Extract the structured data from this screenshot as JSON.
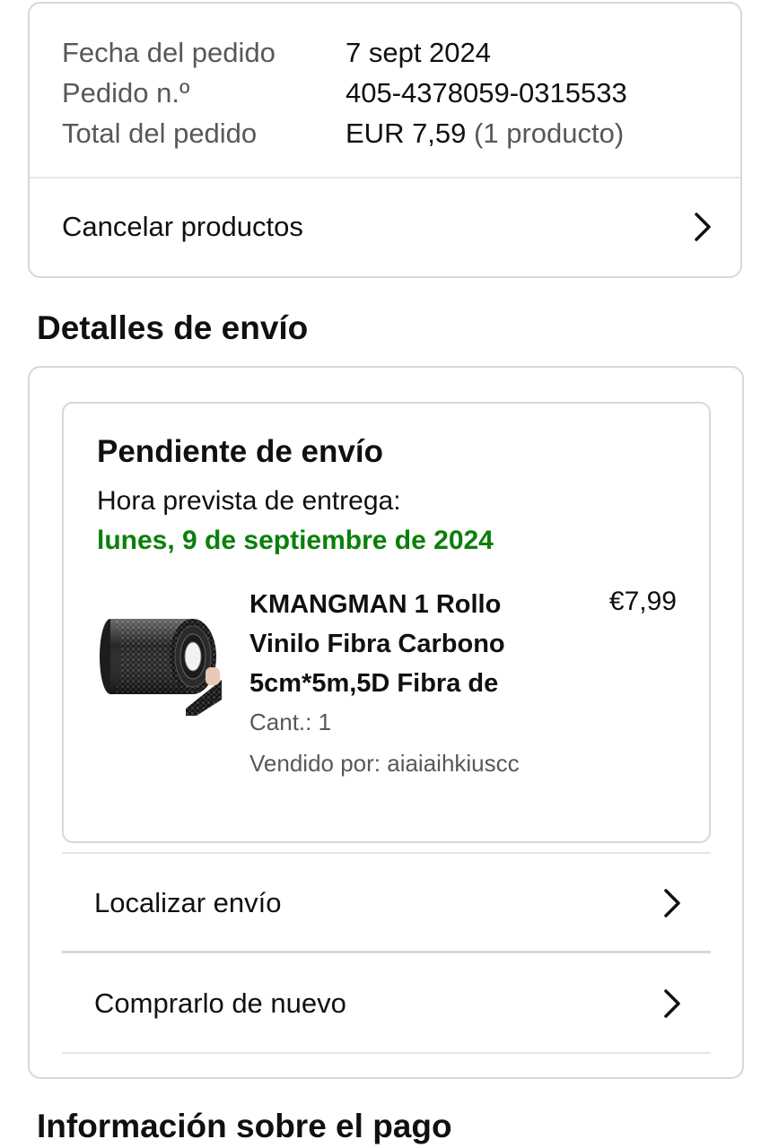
{
  "order_summary": {
    "rows": [
      {
        "label": "Fecha del pedido",
        "value": "7 sept 2024"
      },
      {
        "label": "Pedido n.º",
        "value": "405-4378059-0315533"
      },
      {
        "label": "Total del pedido",
        "value": "EUR 7,59",
        "value_extra": "(1 producto)"
      }
    ],
    "cancel_label": "Cancelar productos"
  },
  "shipping": {
    "section_title": "Detalles de envío",
    "status": "Pendiente de envío",
    "eta_label": "Hora prevista de entrega:",
    "eta_date": "lunes, 9 de septiembre de 2024",
    "product": {
      "title_lines": [
        "KMANGMAN 1 Rollo",
        "Vinilo Fibra Carbono",
        "5cm*5m,5D Fibra de"
      ],
      "price": "€7,99",
      "quantity": "Cant.: 1",
      "seller": "Vendido por: aiaiaihkiuscc",
      "image": "carbon-fiber-vinyl-roll"
    },
    "track_label": "Localizar envío",
    "buy_again_label": "Comprarlo de nuevo"
  },
  "payment": {
    "section_title": "Información sobre el pago"
  },
  "colors": {
    "eta_green": "#0b7f0b",
    "border": "#d5d9d9",
    "muted_text": "#565959"
  }
}
